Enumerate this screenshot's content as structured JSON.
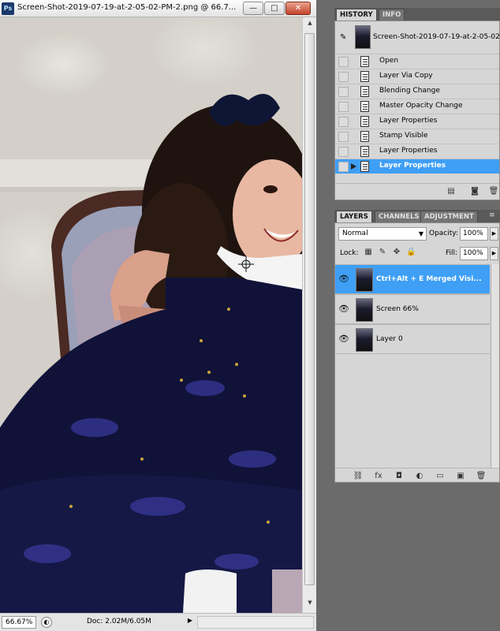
{
  "document": {
    "title": "Screen-Shot-2019-07-19-at-2-05-02-PM-2.png @ 66.7...",
    "app_icon": "Ps",
    "window_buttons": {
      "minimize": "—",
      "maximize": "□",
      "close": "✕"
    },
    "zoom": "66.67%",
    "doc_size": "Doc: 2.02M/6.05M"
  },
  "history": {
    "tabs": [
      {
        "label": "HISTORY"
      },
      {
        "label": "INFO"
      }
    ],
    "snapshot_name": "Screen-Shot-2019-07-19-at-2-05-02-...",
    "steps": [
      {
        "label": "Open"
      },
      {
        "label": "Layer Via Copy"
      },
      {
        "label": "Blending Change"
      },
      {
        "label": "Master Opacity Change"
      },
      {
        "label": "Layer Properties"
      },
      {
        "label": "Stamp Visible"
      },
      {
        "label": "Layer Properties"
      },
      {
        "label": "Layer Properties"
      }
    ],
    "selected_index": 7
  },
  "layers": {
    "tabs": [
      {
        "label": "LAYERS"
      },
      {
        "label": "CHANNELS"
      },
      {
        "label": "ADJUSTMENT"
      }
    ],
    "blend_mode": "Normal",
    "opacity_label": "Opacity:",
    "opacity": "100%",
    "lock_label": "Lock:",
    "fill_label": "Fill:",
    "fill": "100%",
    "items": [
      {
        "name": "Ctrl+Alt + E  Merged Visi..."
      },
      {
        "name": "Screen 66%"
      },
      {
        "name": "Layer 0"
      }
    ],
    "selected_index": 0
  },
  "colors": {
    "selection": "#3f9ff5",
    "panel_bg": "#d6d6d6",
    "workspace": "#6b6b6b"
  }
}
